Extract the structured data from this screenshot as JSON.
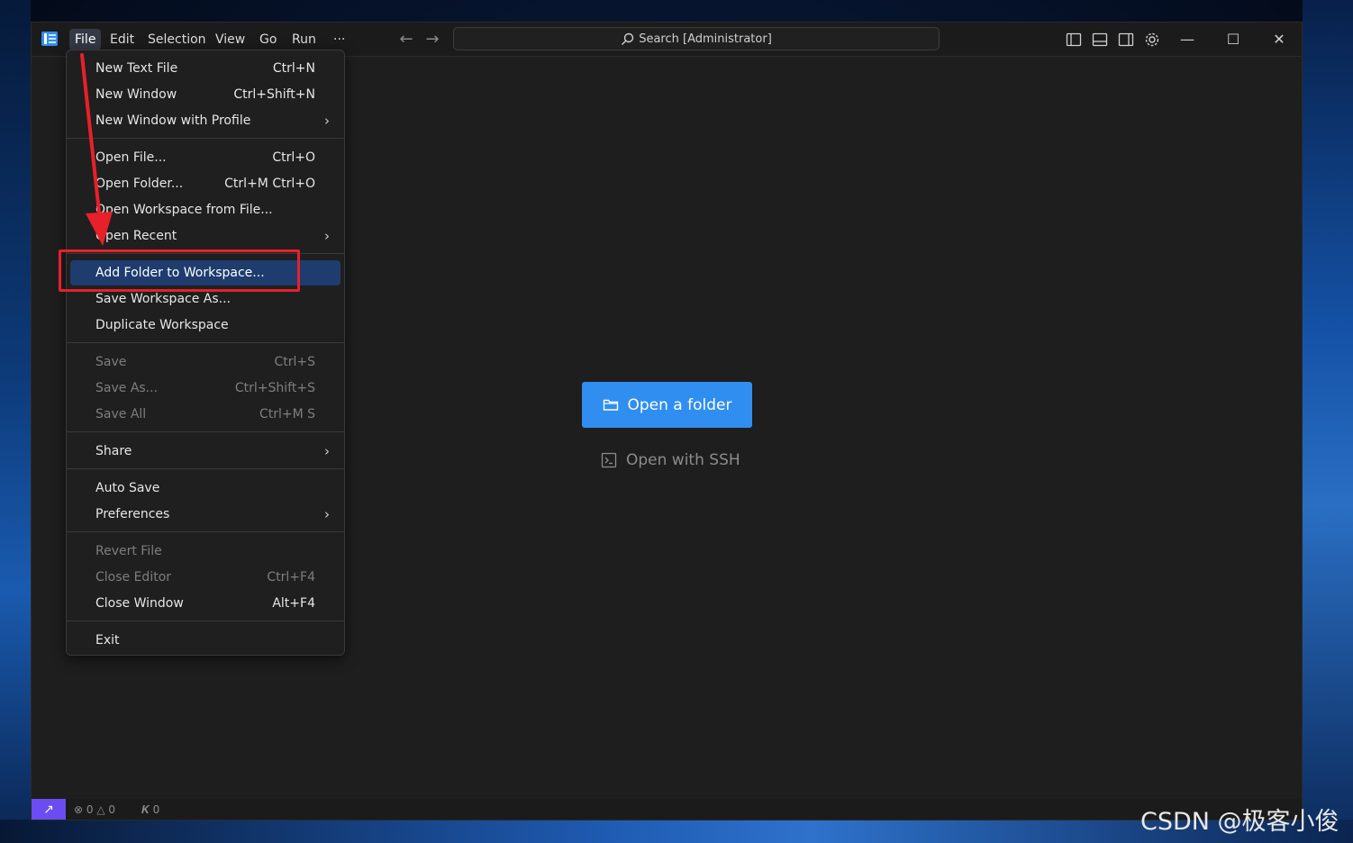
{
  "titlebar": {
    "menus": [
      "File",
      "Edit",
      "Selection",
      "View",
      "Go",
      "Run",
      "···"
    ],
    "search_placeholder": "Search [Administrator]"
  },
  "file_menu": {
    "items": [
      {
        "label": "New Text File",
        "shortcut": "Ctrl+N"
      },
      {
        "label": "New Window",
        "shortcut": "Ctrl+Shift+N"
      },
      {
        "label": "New Window with Profile",
        "submenu": "›"
      },
      {
        "label": "Open File...",
        "shortcut": "Ctrl+O"
      },
      {
        "label": "Open Folder...",
        "shortcut": "Ctrl+M Ctrl+O"
      },
      {
        "label": "Open Workspace from File..."
      },
      {
        "label": "Open Recent",
        "submenu": "›"
      },
      {
        "label": "Add Folder to Workspace...",
        "highlighted": true
      },
      {
        "label": "Save Workspace As..."
      },
      {
        "label": "Duplicate Workspace"
      },
      {
        "label": "Save",
        "shortcut": "Ctrl+S",
        "disabled": true
      },
      {
        "label": "Save As...",
        "shortcut": "Ctrl+Shift+S",
        "disabled": true
      },
      {
        "label": "Save All",
        "shortcut": "Ctrl+M S",
        "disabled": true
      },
      {
        "label": "Share",
        "submenu": "›"
      },
      {
        "label": "Auto Save"
      },
      {
        "label": "Preferences",
        "submenu": "›"
      },
      {
        "label": "Revert File",
        "disabled": true
      },
      {
        "label": "Close Editor",
        "shortcut": "Ctrl+F4",
        "disabled": true
      },
      {
        "label": "Close Window",
        "shortcut": "Alt+F4"
      },
      {
        "label": "Exit"
      }
    ]
  },
  "welcome": {
    "open_folder": "Open a folder",
    "open_ssh": "Open with SSH"
  },
  "statusbar": {
    "errors": "0",
    "warnings": "0",
    "ports": "0"
  },
  "watermark": "CSDN @极客小俊",
  "colors": {
    "accent_button": "#2f8ef0",
    "menu_highlight": "#1f3c6e",
    "remote_button": "#6b4cf0",
    "annotation_red": "#e8202a"
  }
}
